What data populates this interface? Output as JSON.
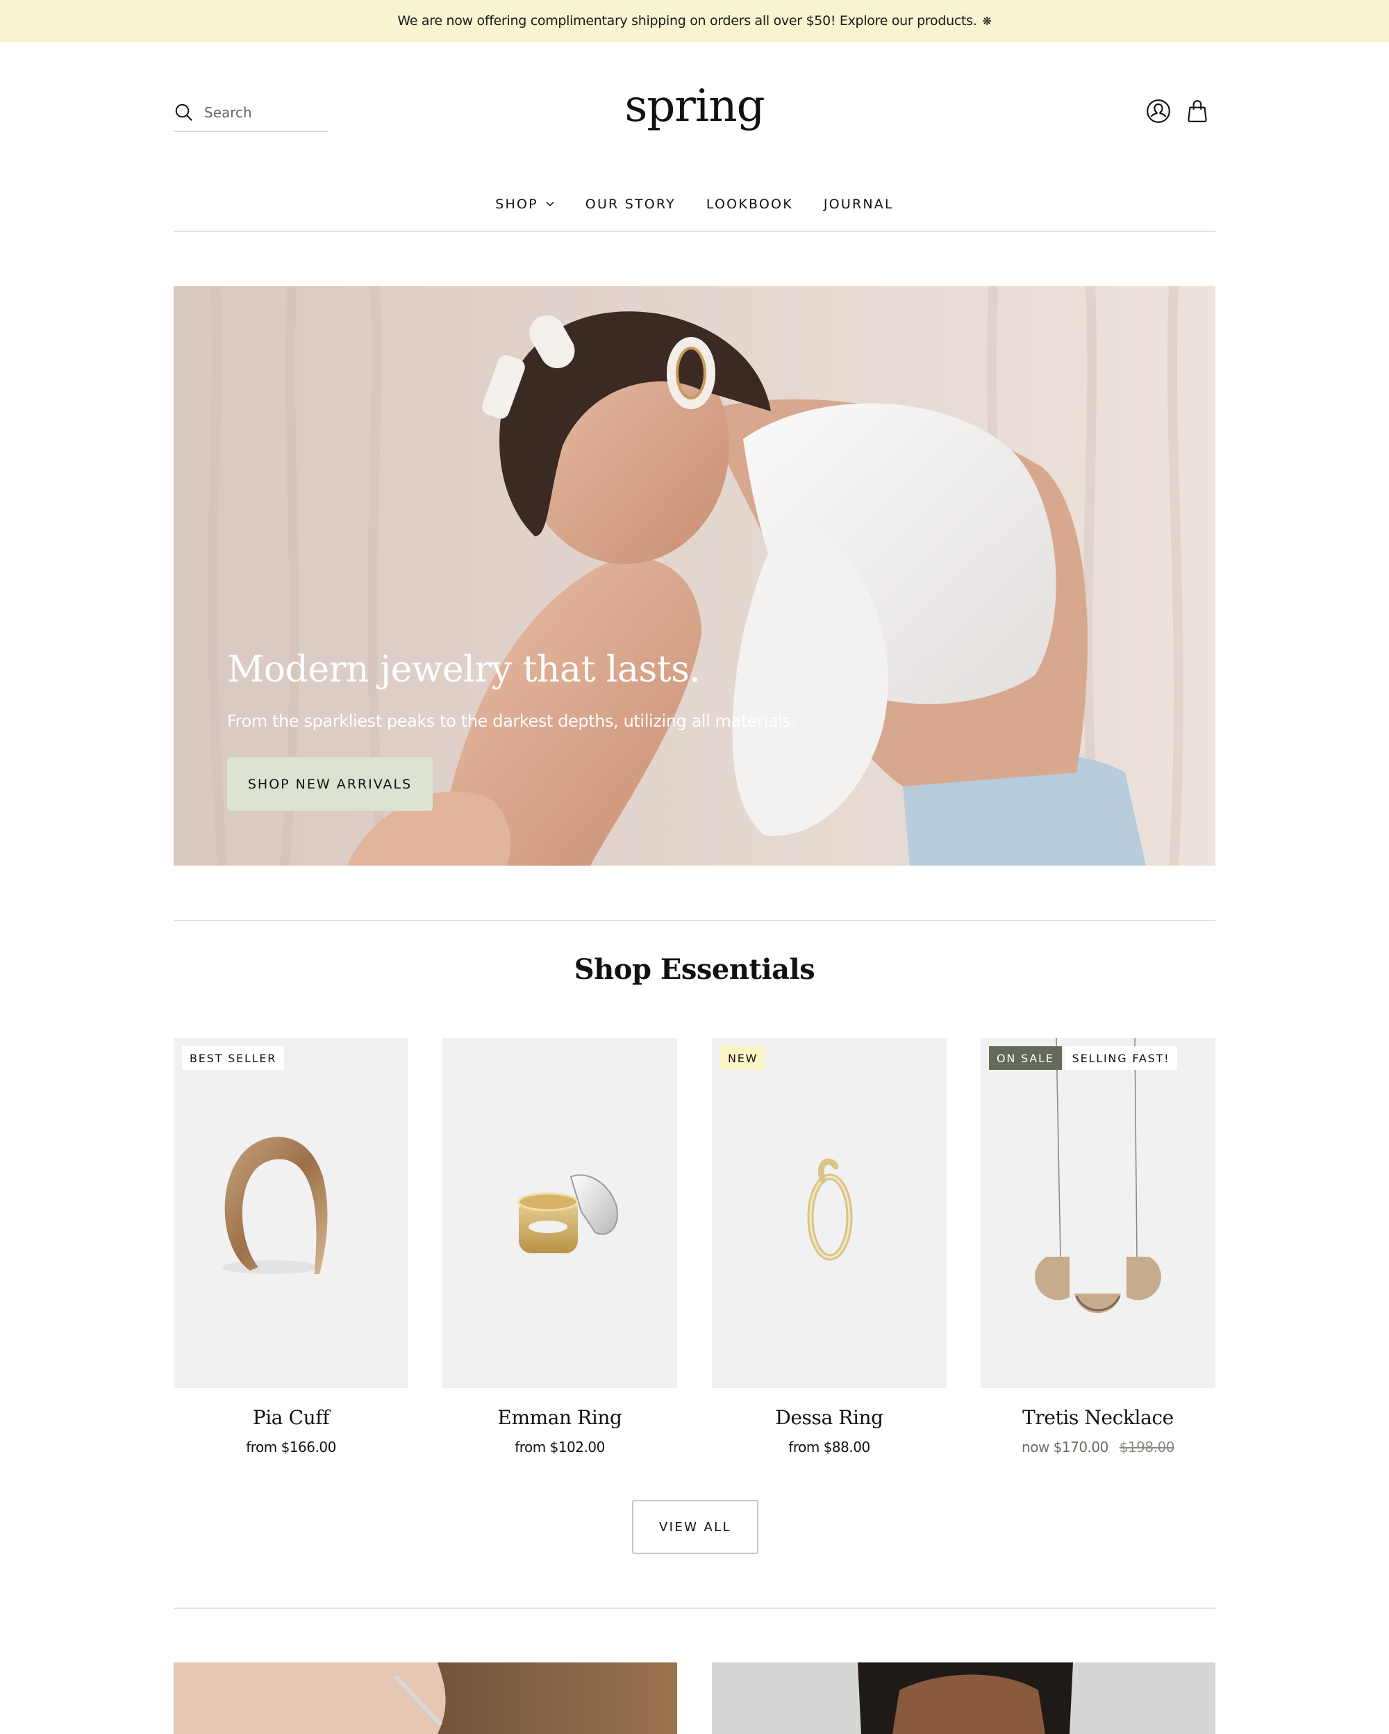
{
  "announcement": {
    "text": "We are now offering complimentary shipping on orders all over $50! Explore our products.",
    "icon": "sparkle-icon",
    "icon_glyph": "❋",
    "background": "#f8f3d0"
  },
  "header": {
    "search": {
      "placeholder": "Search",
      "value": ""
    },
    "logo": "spring",
    "icons": [
      "account-icon",
      "shopping-bag-icon"
    ]
  },
  "nav": {
    "items": [
      {
        "label": "SHOP",
        "has_dropdown": true
      },
      {
        "label": "OUR STORY",
        "has_dropdown": false
      },
      {
        "label": "LOOKBOOK",
        "has_dropdown": false
      },
      {
        "label": "JOURNAL",
        "has_dropdown": false
      }
    ]
  },
  "hero": {
    "title": "Modern jewelry that lasts.",
    "subtitle": "From the sparkliest peaks to the darkest depths, utilizing all materials.",
    "button_label": "SHOP NEW ARRIVALS",
    "button_color": "#dbe4d3",
    "image_alt": "Model with white hair clips and hoop earrings, wearing white puff-sleeve top"
  },
  "essentials": {
    "title": "Shop Essentials",
    "products": [
      {
        "name": "Pia Cuff",
        "price": "from $166.00",
        "badges": [
          {
            "label": "BEST SELLER",
            "style": "white"
          }
        ],
        "image": "gold cuff bracelet"
      },
      {
        "name": "Emman Ring",
        "price": "from $102.00",
        "badges": [],
        "image": "gold and silver stacked rings"
      },
      {
        "name": "Dessa Ring",
        "price": "from $88.00",
        "badges": [
          {
            "label": "NEW",
            "style": "yellow"
          }
        ],
        "image": "gold twist ring"
      },
      {
        "name": "Tretis Necklace",
        "price_now": "now $170.00",
        "price_compare": "$198.00",
        "badges": [
          {
            "label": "ON SALE",
            "style": "dark"
          },
          {
            "label": "SELLING FAST!",
            "style": "white"
          }
        ],
        "image": "half-moon pendant necklace"
      }
    ],
    "view_all_label": "VIEW ALL"
  },
  "colors": {
    "badge_dark": "#636b58",
    "badge_yellow": "#fbf5c6",
    "card_bg": "#f1f1f1",
    "divider": "#e2e2e2"
  }
}
